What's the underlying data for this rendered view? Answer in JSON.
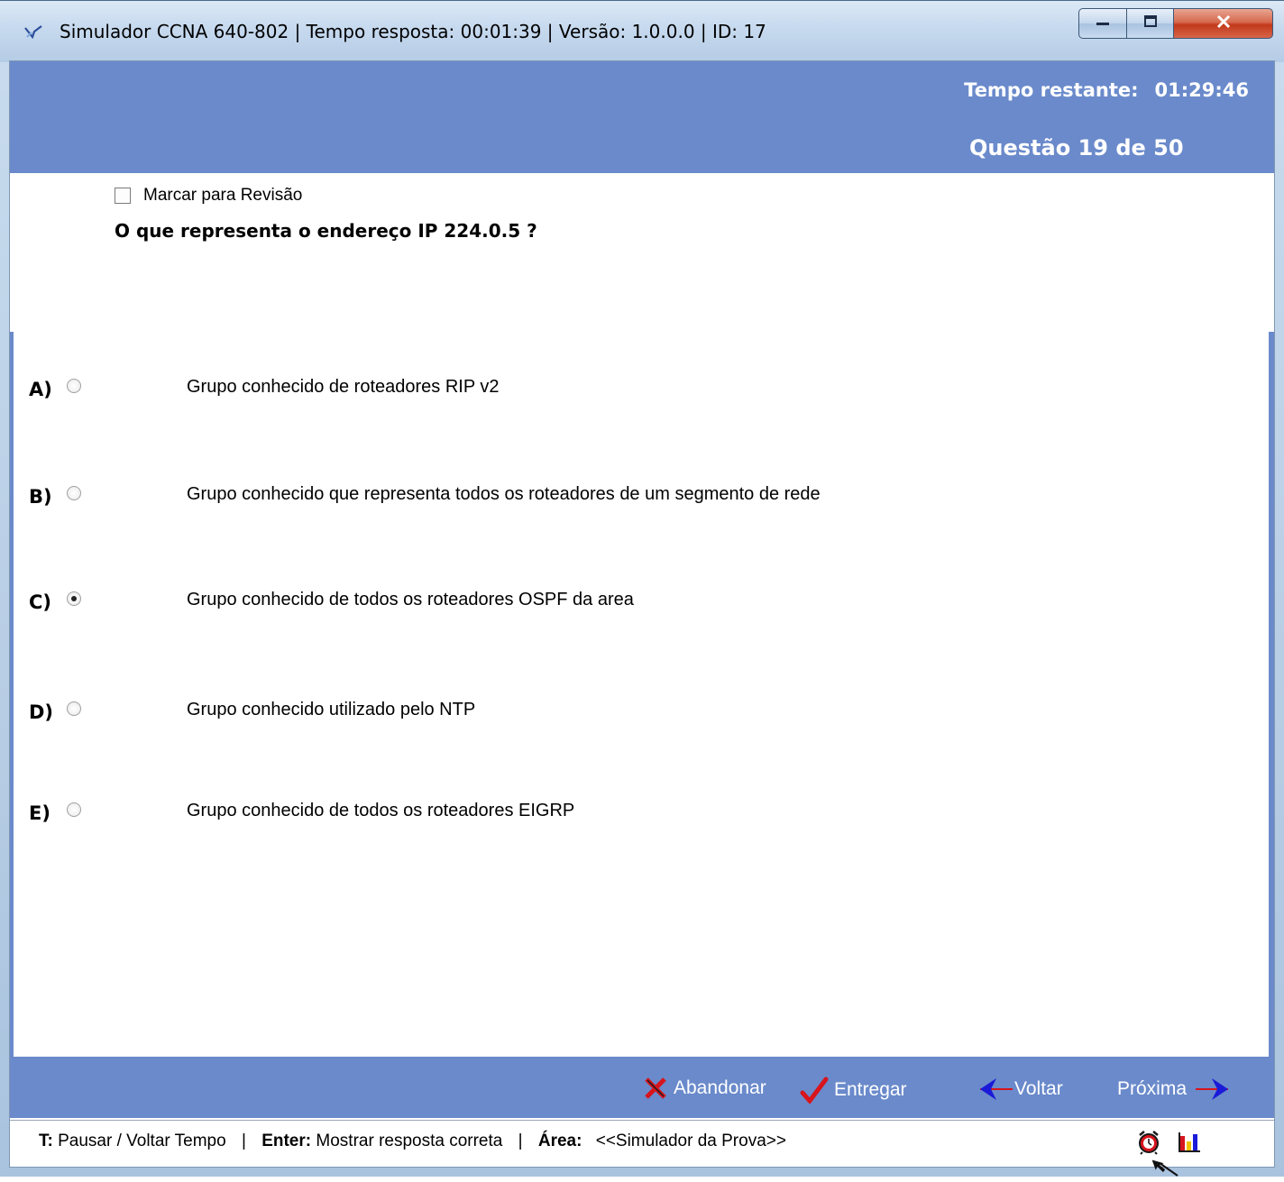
{
  "window": {
    "title": "Simulador CCNA 640-802 | Tempo resposta: 00:01:39 |  Versão: 1.0.0.0 |  ID: 17"
  },
  "header": {
    "time_label": "Tempo restante:",
    "time_value": "01:29:46",
    "question_counter": "Questão 19 de 50"
  },
  "review": {
    "label": "Marcar para Revisão",
    "checked": false
  },
  "question": {
    "text": "O que representa o endereço IP 224.0.5 ?"
  },
  "options": [
    {
      "letter": "A)",
      "text": "Grupo conhecido de roteadores RIP v2",
      "selected": false
    },
    {
      "letter": "B)",
      "text": "Grupo conhecido que representa todos os roteadores de um segmento de rede",
      "selected": false
    },
    {
      "letter": "C)",
      "text": "Grupo conhecido de todos os roteadores OSPF da area",
      "selected": true
    },
    {
      "letter": "D)",
      "text": "Grupo conhecido utilizado pelo NTP",
      "selected": false
    },
    {
      "letter": "E)",
      "text": "Grupo conhecido de todos os roteadores EIGRP",
      "selected": false
    }
  ],
  "footer": {
    "abandon_label": "Abandonar",
    "submit_label": "Entregar",
    "back_label": "Voltar",
    "next_label": "Próxima"
  },
  "status": {
    "key_t": "T:",
    "key_t_desc": "Pausar / Voltar Tempo",
    "key_enter": "Enter:",
    "key_enter_desc": "Mostrar resposta correta",
    "area_label": "Área:",
    "area_value": "<<Simulador da Prova>>"
  },
  "colors": {
    "band": "#6a8acb",
    "abandon_icon": "#d8141d",
    "submit_icon": "#d8141d",
    "nav_arrow": "#1a1ad8"
  },
  "icons": [
    "app-icon",
    "minimize-icon",
    "maximize-icon",
    "close-icon",
    "abandon-x-icon",
    "checkmark-icon",
    "back-arrow-icon",
    "next-arrow-icon",
    "alarm-clock-icon",
    "chart-icon",
    "mouse-cursor-icon"
  ]
}
